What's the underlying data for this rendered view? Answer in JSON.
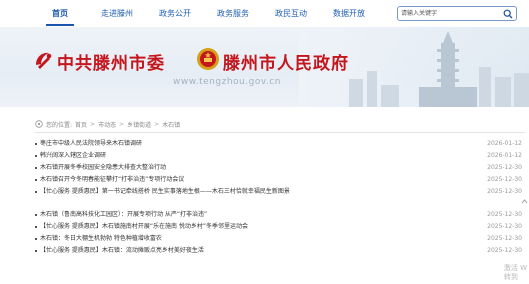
{
  "nav": {
    "items": [
      {
        "label": "首页",
        "active": true
      },
      {
        "label": "走进滕州",
        "active": false
      },
      {
        "label": "政务公开",
        "active": false
      },
      {
        "label": "政务服务",
        "active": false
      },
      {
        "label": "政民互动",
        "active": false
      },
      {
        "label": "数据开放",
        "active": false
      }
    ]
  },
  "search": {
    "placeholder": "请输入关键字",
    "icon": "search-icon"
  },
  "banner": {
    "party_title": "中共滕州市委",
    "gov_title": "滕州市人民政府",
    "url": "www.tengzhou.gov.cn",
    "colors": {
      "title": "#c4161c",
      "nav": "#1f5fb0"
    }
  },
  "breadcrumb": {
    "items": [
      "您的位置:",
      "首页",
      "市动态",
      "乡镇街道",
      "木石镇"
    ],
    "separator": ">"
  },
  "news": {
    "group1": [
      {
        "title": "枣庄市中级人民法院领导来木石镇调研",
        "date": "2026-01-12"
      },
      {
        "title": "韩兴阔深入辖区企业调研",
        "date": "2026-01-12"
      },
      {
        "title": "木石镇开展冬季校园安全隐患大排查大整治行动",
        "date": "2025-12-30"
      },
      {
        "title": "木石镇召开今冬明春能征攀打“打非治违”专项行动会议",
        "date": "2025-12-30"
      },
      {
        "title": "【忙心服务 提质惠民】第一书记牵线搭桥 民生实事落地生根——木石三村恰就幸福民生新图景",
        "date": "2025-12-30"
      }
    ],
    "group2": [
      {
        "title": "木石镇（鲁南高科技化工园区）：开展专项行动 从严“打非治违”",
        "date": "2025-12-30"
      },
      {
        "title": "【忙心服务 提质惠民】木石镇施南村开展“乐在施南 悦动乡村”冬季邻里运动会",
        "date": "2025-12-30"
      },
      {
        "title": "木石镇：冬日大棚生机勃勃 特色种植增收富农",
        "date": "2025-12-30"
      },
      {
        "title": "【忙心服务 提质惠民】木石镇：流动摊贩点亮乡村美好夜生活",
        "date": "2025-12-30"
      }
    ]
  },
  "watermark": {
    "line1": "激活 W",
    "line2": "转到"
  }
}
